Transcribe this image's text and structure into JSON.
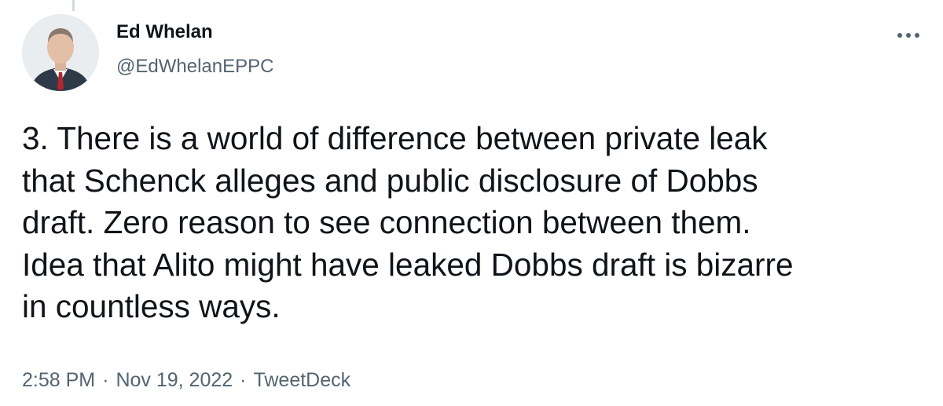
{
  "author": {
    "name": "Ed Whelan",
    "handle": "@EdWhelanEPPC"
  },
  "tweet": {
    "text": "3. There is a world of difference between private leak\nthat Schenck alleges and public disclosure of Dobbs\ndraft. Zero reason to see connection between them.\nIdea that Alito might have leaked Dobbs draft is bizarre\nin countless ways."
  },
  "meta": {
    "time": "2:58 PM",
    "separator": "·",
    "date": "Nov 19, 2022",
    "source": "TweetDeck"
  },
  "icons": {
    "more": "more-options-icon"
  },
  "colors": {
    "primary_text": "#0f1419",
    "secondary_text": "#536471",
    "thread_line": "#cfd9de"
  }
}
